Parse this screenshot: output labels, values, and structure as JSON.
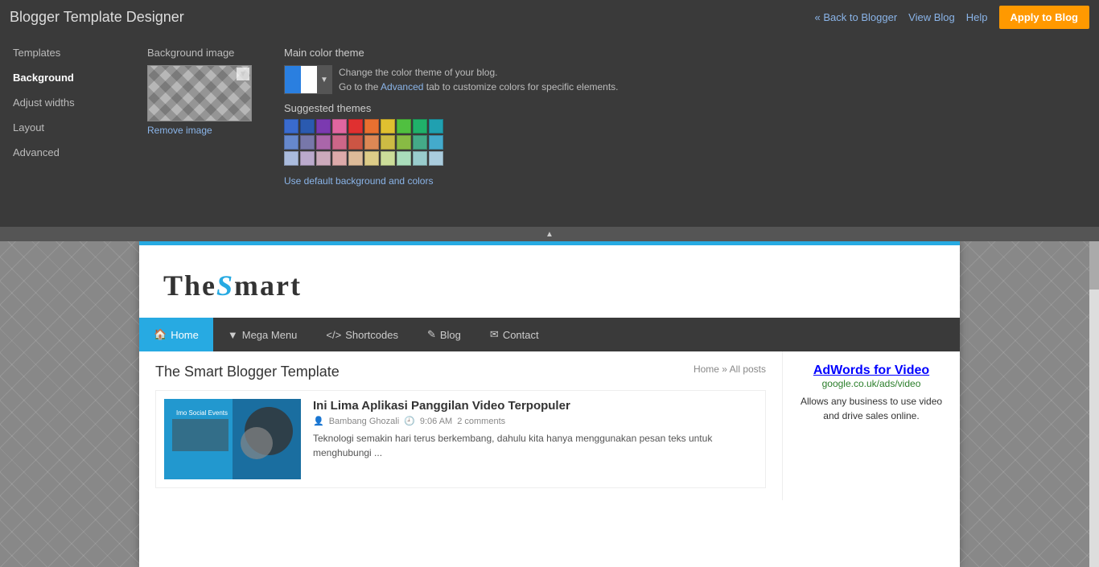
{
  "app": {
    "title": "Blogger Template Designer",
    "links": {
      "back": "« Back to Blogger",
      "viewBlog": "View Blog",
      "help": "Help",
      "applyBtn": "Apply to Blog"
    }
  },
  "sidebar": {
    "items": [
      {
        "id": "templates",
        "label": "Templates"
      },
      {
        "id": "background",
        "label": "Background"
      },
      {
        "id": "adjust-widths",
        "label": "Adjust widths"
      },
      {
        "id": "layout",
        "label": "Layout"
      },
      {
        "id": "advanced",
        "label": "Advanced"
      }
    ]
  },
  "background": {
    "imageLabel": "Background image",
    "removeLink": "Remove image",
    "colorThemeLabel": "Main color theme",
    "colorDescription": "Change the color theme of your blog.\nGo to the Advanced tab to customize colors for specific elements.",
    "suggestedLabel": "Suggested themes",
    "defaultLink": "Use default background and colors",
    "swatches": [
      "#3a6bce",
      "#2a5ab0",
      "#7b3ab0",
      "#e066a0",
      "#e03030",
      "#e87030",
      "#e0c030",
      "#50c040",
      "#20b06a",
      "#20a0b0",
      "#6688cc",
      "#7777aa",
      "#aa66aa",
      "#cc6688",
      "#cc5544",
      "#dd8855",
      "#ccbb44",
      "#88bb44",
      "#44aa88",
      "#44aacc",
      "#aabbdd",
      "#bbaacc",
      "#ccaabb",
      "#ddaaaa",
      "#ddbb99",
      "#ddcc88",
      "#ccdd99",
      "#aaddbb",
      "#99cccc",
      "#aaccdd"
    ]
  },
  "preview": {
    "logoText": "THE",
    "logoS": "S",
    "logoRest": "MART",
    "nav": {
      "items": [
        {
          "icon": "🏠",
          "label": "Home"
        },
        {
          "icon": "↓",
          "label": "Mega Menu"
        },
        {
          "icon": "</>",
          "label": "Shortcodes"
        },
        {
          "icon": "✎",
          "label": "Blog"
        },
        {
          "icon": "✉",
          "label": "Contact"
        }
      ]
    },
    "pageTitle": "The Smart Blogger Template",
    "breadcrumb": "Home » All posts",
    "post": {
      "title": "Ini Lima Aplikasi Panggilan Video Terpopuler",
      "author": "Bambang Ghozali",
      "time": "9:06 AM",
      "comments": "2 comments",
      "excerpt": "Teknologi semakin hari terus berkembang, dahulu kita hanya menggunakan pesan teks untuk menghubungi ..."
    },
    "adTitle": "AdWords for Video",
    "adUrl": "google.co.uk/ads/video",
    "adText": "Allows any business to use video and drive sales online."
  }
}
